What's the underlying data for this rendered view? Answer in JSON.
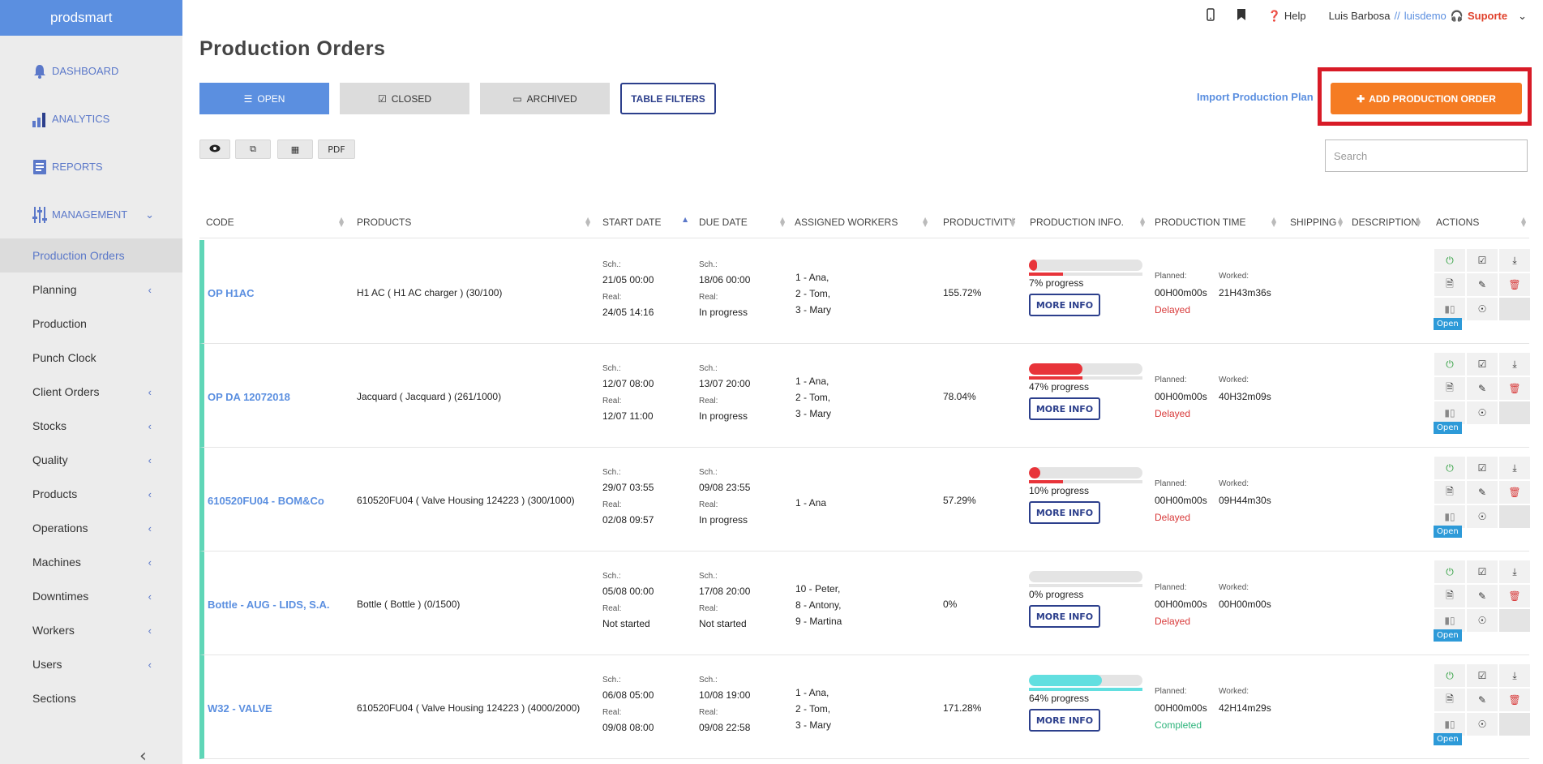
{
  "brand": "prodsmart",
  "sidebar": {
    "main": [
      {
        "label": "DASHBOARD",
        "icon": "bell-icon"
      },
      {
        "label": "ANALYTICS",
        "icon": "bar-chart-icon"
      },
      {
        "label": "REPORTS",
        "icon": "report-icon"
      },
      {
        "label": "MANAGEMENT",
        "icon": "sliders-icon"
      }
    ],
    "items": [
      {
        "label": "Production Orders",
        "active": true,
        "chevron": false
      },
      {
        "label": "Planning",
        "chevron": true
      },
      {
        "label": "Production",
        "chevron": false
      },
      {
        "label": "Punch Clock",
        "chevron": false
      },
      {
        "label": "Client Orders",
        "chevron": true
      },
      {
        "label": "Stocks",
        "chevron": true
      },
      {
        "label": "Quality",
        "chevron": true
      },
      {
        "label": "Products",
        "chevron": true
      },
      {
        "label": "Operations",
        "chevron": true
      },
      {
        "label": "Machines",
        "chevron": true
      },
      {
        "label": "Downtimes",
        "chevron": true
      },
      {
        "label": "Workers",
        "chevron": true
      },
      {
        "label": "Users",
        "chevron": true
      },
      {
        "label": "Sections",
        "chevron": false
      }
    ]
  },
  "topbar": {
    "help": "Help",
    "user": "Luis Barbosa",
    "sep": "//",
    "tenant": "luisdemo",
    "support": "Suporte"
  },
  "page_title": "Production Orders",
  "tabs": {
    "open": "OPEN",
    "closed": "CLOSED",
    "archived": "ARCHIVED",
    "filters": "TABLE FILTERS"
  },
  "import_link": "Import Production Plan",
  "add_button": "ADD PRODUCTION ORDER",
  "toolbar": {
    "pdf": "PDF"
  },
  "search_placeholder": "Search",
  "columns": [
    "CODE",
    "PRODUCTS",
    "START DATE",
    "DUE DATE",
    "ASSIGNED WORKERS",
    "PRODUCTIVITY",
    "PRODUCTION INFO.",
    "PRODUCTION TIME",
    "SHIPPING",
    "DESCRIPTION",
    "ACTIONS"
  ],
  "labels": {
    "sch": "Sch.:",
    "real": "Real:",
    "planned": "Planned:",
    "worked": "Worked:",
    "more_info": "MORE INFO",
    "open_badge": "Open"
  },
  "rows": [
    {
      "code": "OP H1AC",
      "product": "H1 AC ( H1 AC charger ) (30/100)",
      "start_sch": "21/05  00:00",
      "start_real": "24/05  14:16",
      "due_sch": "18/06  00:00",
      "due_real": "In progress",
      "workers": [
        "1 - Ana,",
        "2 - Tom,",
        "3 - Mary"
      ],
      "productivity": "155.72%",
      "progress_text": "7% progress",
      "progress": 0.07,
      "bar_color": "#e8343a",
      "planned": "00H00m00s",
      "worked": "21H43m36s",
      "status": "Delayed",
      "status_class": "delayed"
    },
    {
      "code": "OP DA 12072018",
      "product": "Jacquard ( Jacquard ) (261/1000)",
      "start_sch": "12/07  08:00",
      "start_real": "12/07  11:00",
      "due_sch": "13/07  20:00",
      "due_real": "In progress",
      "workers": [
        "1 - Ana,",
        "2 - Tom,",
        "3 - Mary"
      ],
      "productivity": "78.04%",
      "progress_text": "47% progress",
      "progress": 0.47,
      "bar_color": "#e8343a",
      "planned": "00H00m00s",
      "worked": "40H32m09s",
      "status": "Delayed",
      "status_class": "delayed"
    },
    {
      "code": "610520FU04 - BOM&Co",
      "product": "610520FU04 ( Valve Housing 124223 ) (300/1000)",
      "start_sch": "29/07  03:55",
      "start_real": "02/08  09:57",
      "due_sch": "09/08  23:55",
      "due_real": "In progress",
      "workers": [
        "1 - Ana"
      ],
      "productivity": "57.29%",
      "progress_text": "10% progress",
      "progress": 0.1,
      "bar_color": "#e8343a",
      "planned": "00H00m00s",
      "worked": "09H44m30s",
      "status": "Delayed",
      "status_class": "delayed"
    },
    {
      "code": "Bottle - AUG - LIDS, S.A.",
      "product": "Bottle ( Bottle ) (0/1500)",
      "start_sch": "05/08  00:00",
      "start_real": "Not started",
      "due_sch": "17/08  20:00",
      "due_real": "Not started",
      "workers": [
        "10 - Peter,",
        "8 - Antony,",
        "9 - Martina"
      ],
      "productivity": "0%",
      "progress_text": "0% progress",
      "progress": 0.0,
      "bar_color": "#e8343a",
      "planned": "00H00m00s",
      "worked": "00H00m00s",
      "status": "Delayed",
      "status_class": "delayed"
    },
    {
      "code": "W32 - VALVE",
      "product": "610520FU04 ( Valve Housing 124223 ) (4000/2000)",
      "start_sch": "06/08  05:00",
      "start_real": "09/08  08:00",
      "due_sch": "10/08  19:00",
      "due_real": "09/08  22:58",
      "workers": [
        "1 - Ana,",
        "2 - Tom,",
        "3 - Mary"
      ],
      "productivity": "171.28%",
      "progress_text": "64% progress",
      "progress": 0.64,
      "bar_color": "#62dfe0",
      "planned": "00H00m00s",
      "worked": "42H14m29s",
      "status": "Completed",
      "status_class": "completed"
    }
  ]
}
